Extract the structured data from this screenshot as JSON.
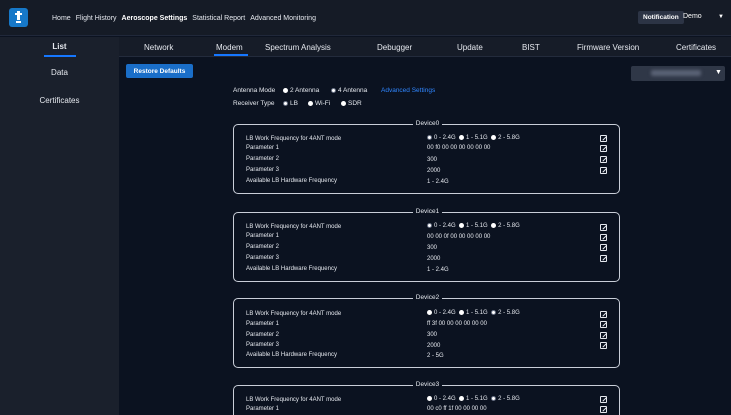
{
  "header": {
    "nav": [
      "Home",
      "Flight History",
      "Aeroscope Settings",
      "Statistical Report",
      "Advanced Monitoring"
    ],
    "active_nav": "Aeroscope Settings",
    "notification": "Notification",
    "user": "Demo"
  },
  "sidebar": {
    "items": [
      {
        "label": "List"
      },
      {
        "label": "Data"
      },
      {
        "label": "Certificates"
      }
    ]
  },
  "tabs": [
    "Network",
    "Modem",
    "Spectrum Analysis",
    "Debugger",
    "Update",
    "BIST",
    "Firmware Version",
    "Certificates"
  ],
  "active_tab": "Modem",
  "main": {
    "restore_label": "Restore Defaults",
    "select_value": "",
    "antenna_mode_label": "Antenna Mode",
    "antenna_options": [
      "2 Antenna",
      "4 Antenna"
    ],
    "advanced_settings": "Advanced Settings",
    "receiver_type_label": "Receiver Type",
    "receiver_options": [
      "LB",
      "Wi-Fi",
      "SDR"
    ]
  },
  "devices": [
    {
      "title": "Device0",
      "rows": [
        {
          "label": "LB Work Frequency for 4ANT mode",
          "value": [
            "0 - 2.4G",
            "1 - 5.1G",
            "2 - 5.8G"
          ],
          "editable": true
        },
        {
          "label": "Parameter 1",
          "value": "00 f0 00 00 00 00 00 00",
          "editable": true
        },
        {
          "label": "Parameter 2",
          "value": "300",
          "editable": true
        },
        {
          "label": "Parameter 3",
          "value": "2000",
          "editable": true
        },
        {
          "label": "Available LB Hardware Frequency",
          "value": "1 - 2.4G",
          "editable": false
        }
      ]
    },
    {
      "title": "Device1",
      "rows": [
        {
          "label": "LB Work Frequency for 4ANT mode",
          "value": [
            "0 - 2.4G",
            "1 - 5.1G",
            "2 - 5.8G"
          ],
          "editable": true
        },
        {
          "label": "Parameter 1",
          "value": "00 00 0f 00 00 00 00 00",
          "editable": true
        },
        {
          "label": "Parameter 2",
          "value": "300",
          "editable": true
        },
        {
          "label": "Parameter 3",
          "value": "2000",
          "editable": true
        },
        {
          "label": "Available LB Hardware Frequency",
          "value": "1 - 2.4G",
          "editable": false
        }
      ]
    },
    {
      "title": "Device2",
      "rows": [
        {
          "label": "LB Work Frequency for 4ANT mode",
          "value": [
            "0 - 2.4G",
            "1 - 5.1G",
            "2 - 5.8G"
          ],
          "editable": true
        },
        {
          "label": "Parameter 1",
          "value": "ff 3f 00 00 00 00 00 00",
          "editable": true
        },
        {
          "label": "Parameter 2",
          "value": "300",
          "editable": true
        },
        {
          "label": "Parameter 3",
          "value": "2000",
          "editable": true
        },
        {
          "label": "Available LB Hardware Frequency",
          "value": "2 - 5G",
          "editable": false
        }
      ]
    },
    {
      "title": "Device3",
      "rows": [
        {
          "label": "LB Work Frequency for 4ANT mode",
          "value": [
            "0 - 2.4G",
            "1 - 5.1G",
            "2 - 5.8G"
          ],
          "editable": true
        },
        {
          "label": "Parameter 1",
          "value": "00 c0 ff 1f 00 00 00 00",
          "editable": true
        }
      ]
    }
  ]
}
